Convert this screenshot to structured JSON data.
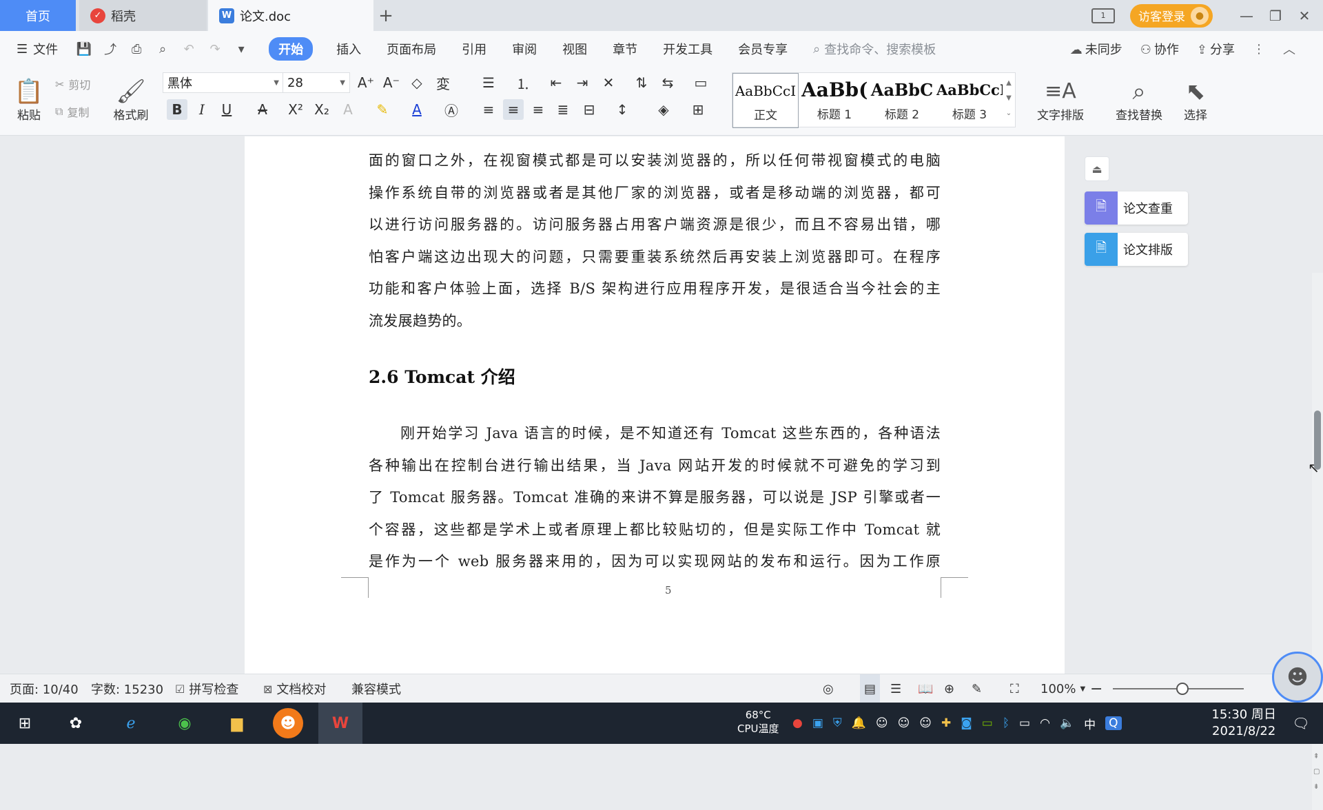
{
  "tabs": {
    "home": "首页",
    "daoke": "稻壳",
    "doc": "论文.doc",
    "add": "+"
  },
  "title_right": {
    "login": "访客登录"
  },
  "menubar": {
    "file": "文件",
    "items": [
      "开始",
      "插入",
      "页面布局",
      "引用",
      "审阅",
      "视图",
      "章节",
      "开发工具",
      "会员专享"
    ],
    "search_placeholder": "查找命令、搜索模板",
    "sync": "未同步",
    "collab": "协作",
    "share": "分享"
  },
  "ribbon": {
    "paste": "粘贴",
    "cut": "剪切",
    "copy": "复制",
    "format_painter": "格式刷",
    "font_name": "黑体",
    "font_size": "28",
    "styles": [
      {
        "preview": "AaBbCcI",
        "name": "正文"
      },
      {
        "preview": "AaBb(",
        "name": "标题 1"
      },
      {
        "preview": "AaBbC",
        "name": "标题 2"
      },
      {
        "preview": "AaBbCcI",
        "name": "标题 3"
      }
    ],
    "text_layout": "文字排版",
    "find_replace": "查找替换",
    "select": "选择"
  },
  "document": {
    "para1": [
      "面的窗口之外，在视窗模式都是可以安装浏览器的，所以任何带视窗模式的电脑",
      "操作系统自带的浏览器或者是其他厂家的浏览器，或者是移动端的浏览器，都可",
      "以进行访问服务器的。访问服务器占用客户端资源是很少，而且不容易出错，哪",
      "怕客户端这边出现大的问题，只需要重装系统然后再安装上浏览器即可。在程序",
      "功能和客户体验上面，选择 B/S 架构进行应用程序开发，是很适合当今社会的主",
      "流发展趋势的。"
    ],
    "heading": "2.6 Tomcat  介绍",
    "para2": [
      "刚开始学习 Java 语言的时候，是不知道还有 Tomcat 这些东西的，各种语法",
      "各种输出在控制台进行输出结果，当 Java 网站开发的时候就不可避免的学习到",
      "了 Tomcat 服务器。Tomcat 准确的来讲不算是服务器，可以说是 JSP 引擎或者一",
      "个容器，这些都是学术上或者原理上都比较贴切的，但是实际工作中 Tomcat 就",
      "是作为一个 web 服务器来用的，因为可以实现网站的发布和运行。因为工作原"
    ],
    "page_number": "5"
  },
  "side_panel": {
    "check": "论文查重",
    "layout": "论文排版"
  },
  "statusbar": {
    "page": "页面: 10/40",
    "words": "字数: 15230",
    "spell": "拼写检查",
    "proof": "文档校对",
    "compat": "兼容模式",
    "zoom": "100%"
  },
  "taskbar": {
    "cpu_temp": "68°C",
    "cpu_label": "CPU温度",
    "ime": "中",
    "time": "15:30 周日",
    "date": "2021/8/22"
  },
  "colors": {
    "accent": "#4e8cf6",
    "login": "#f5a623",
    "check_icon": "#7b7fe8",
    "layout_icon": "#3aa0e8",
    "taskbar": "#1d2530"
  }
}
